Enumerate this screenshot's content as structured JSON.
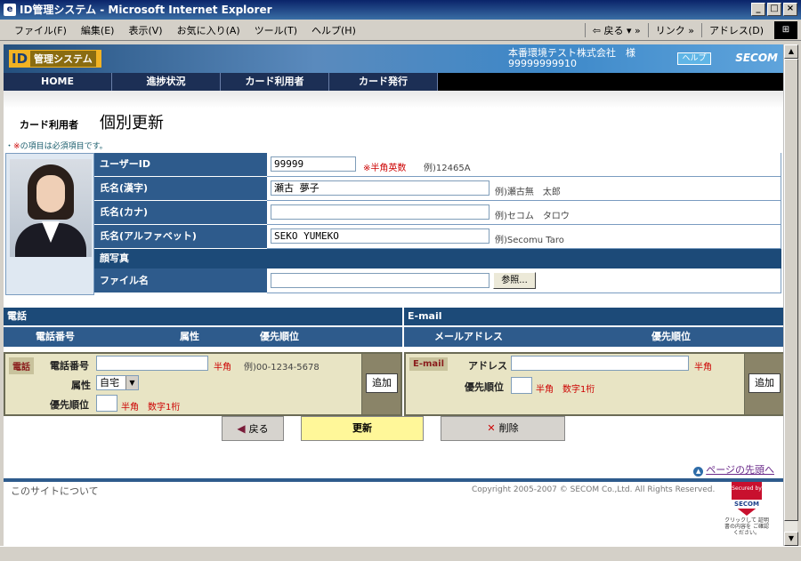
{
  "window": {
    "title": "ID管理システム - Microsoft Internet Explorer",
    "minimize_glyph": "_",
    "maximize_glyph": "□",
    "close_glyph": "×"
  },
  "browser_menu": {
    "items": [
      "ファイル(F)",
      "編集(E)",
      "表示(V)",
      "お気に入り(A)",
      "ツール(T)",
      "ヘルプ(H)"
    ],
    "back": "戻る",
    "links": "リンク",
    "address": "アドレス(D)"
  },
  "header": {
    "logo_id": "ID",
    "logo_system": "管理システム",
    "company_name": "本番環境テスト株式会社　様",
    "company_code": "99999999910",
    "help_label": "ヘルプ",
    "brand": "SECOM"
  },
  "nav": {
    "items": [
      "HOME",
      "進捗状況",
      "カード利用者",
      "カード発行"
    ]
  },
  "page": {
    "category": "カード利用者",
    "heading": "個別更新",
    "required_mark": "※",
    "required_note": "の項目は必須項目です。"
  },
  "form": {
    "user_id": {
      "label": "ユーザーID",
      "value": "99999",
      "required": "※半角英数",
      "example": "例)12465A"
    },
    "name_kanji": {
      "label": "氏名(漢字)",
      "value": "瀬古 夢子",
      "example": "例)瀬古無　太郎"
    },
    "name_kana": {
      "label": "氏名(カナ)",
      "value": "",
      "example": "例)セコム　タロウ"
    },
    "name_alpha": {
      "label": "氏名(アルファベット)",
      "value": "SEKO YUMEKO",
      "example": "例)Secomu Taro"
    },
    "photo_section": "顔写真",
    "file_name": {
      "label": "ファイル名",
      "value": "",
      "browse": "参照..."
    }
  },
  "phone": {
    "heading": "電話",
    "col_number": "電話番号",
    "col_attr": "属性",
    "col_priority": "優先順位",
    "tag": "電話",
    "number_label": "電話番号",
    "number_value": "",
    "number_note": "半角",
    "number_example": "例)00-1234-5678",
    "attr_label": "属性",
    "attr_value": "自宅",
    "priority_label": "優先順位",
    "priority_value": "",
    "priority_note": "半角　数字1桁",
    "add": "追加"
  },
  "email": {
    "heading": "E-mail",
    "col_address": "メールアドレス",
    "col_priority": "優先順位",
    "tag": "E-mail",
    "address_label": "アドレス",
    "address_value": "",
    "address_note": "半角",
    "priority_label": "優先順位",
    "priority_value": "",
    "priority_note": "半角　数字1桁",
    "add": "追加"
  },
  "actions": {
    "back": "戻る",
    "update": "更新",
    "delete": "削除"
  },
  "footer": {
    "page_top": "ページの先頭へ",
    "about": "このサイトについて",
    "copyright": "Copyright 2005-2007 © SECOM Co.,Ltd. All Rights Reserved.",
    "badge_top": "Secured by",
    "badge_brand": "SECOM",
    "badge_note": "クリックして 証明書の内容を ご確認ください。"
  }
}
